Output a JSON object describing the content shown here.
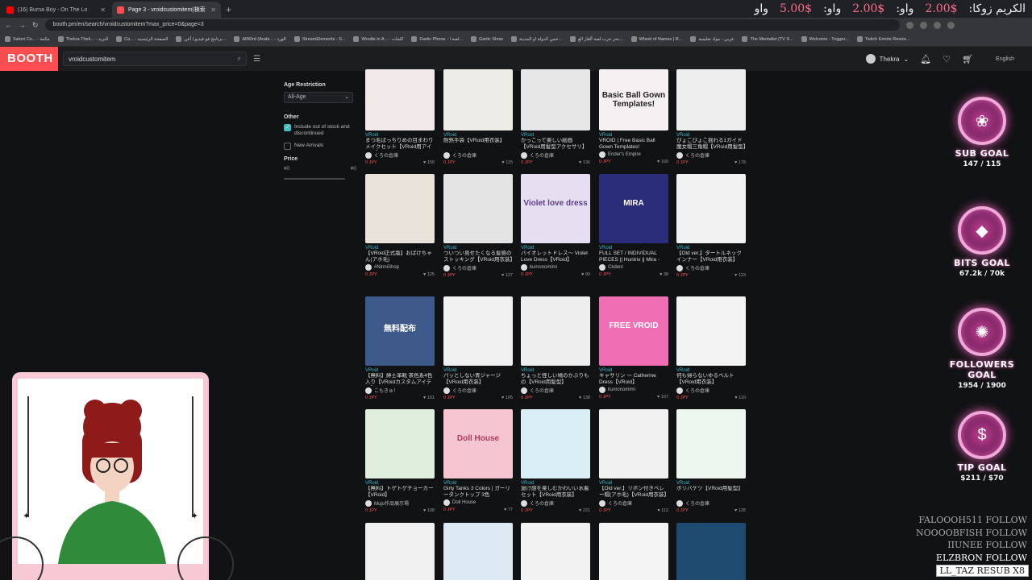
{
  "browser": {
    "tabs": [
      {
        "title": "(16) Burna Boy - On The Lo",
        "color": "#ff0000"
      },
      {
        "title": "Page 3 - vroidcustomitem(検索",
        "color": "#fc4d50"
      }
    ],
    "url": "booth.pm/en/search/vroidcustomitem?max_price=0&page=3",
    "bookmarks": [
      "Saloni Co... - مكتبة",
      "Thekra Thek... - البريد",
      "Ca... - الصفحة الرئيسية",
      "برنامج فو فيديو | أغن...",
      "AllWird (Arabi... - الورد",
      "StreamElements - S...",
      "Wordle in A... - كلمات",
      "Gartic Phone - لعبة ا...",
      "Gartic Show",
      "خمن الدولة او المدينة...",
      "بحر حرب لعبة ألغاز الع...",
      "Wheel of Names | R...",
      "عربي - مواد تعليمية",
      "The Mentalist (TV S...",
      "Welcome - Trigger...",
      "Twitch Emote Resize..."
    ]
  },
  "donations": {
    "a_label": "الكريم زوكا:",
    "a_amt": "2.00$",
    "b_label": "واو:",
    "b_amt": "2.00$",
    "c_label": "واو:",
    "c_amt": "5.00$",
    "d_label": "واو"
  },
  "booth": {
    "logo": "BOOTH",
    "search_value": "vroidcustomitem",
    "username": "Thekra",
    "language": "English"
  },
  "filters": {
    "age_title": "Age Restriction",
    "age_value": "All-Age",
    "other_title": "Other",
    "include_label": "Include out of stock and discontinued",
    "new_label": "New Arrivals",
    "price_title": "Price",
    "price_min": "¥0",
    "price_max": "¥0"
  },
  "products": [
    {
      "cat": "VRoid",
      "name": "まつ毛ばっちりめの目まわりメイクセット【VRoid用アイテム】",
      "shop": "くろの倉庫",
      "price": "0 JPY",
      "likes": "150",
      "bg": "#f1e9ea",
      "label": "",
      "lc": "#000"
    },
    {
      "cat": "VRoid",
      "name": "耐熱手袋【VRoid用衣装】",
      "shop": "くろの倉庫",
      "price": "0 JPY",
      "likes": "115",
      "bg": "#ecebe6",
      "label": "",
      "lc": "#000"
    },
    {
      "cat": "VRoid",
      "name": "かっこって楽しい絵画【VRoid用髪型アクセサリ】",
      "shop": "くろの倉庫",
      "price": "0 JPY",
      "likes": "136",
      "bg": "#e6e6e6",
      "label": "",
      "lc": "#000"
    },
    {
      "cat": "VRoid",
      "name": "VROID | Free Basic Ball Gown Templates!",
      "shop": "Ender's Empire",
      "price": "0 JPY",
      "likes": "160",
      "bg": "#f5f0f2",
      "label": "Basic Ball Gown Templates!",
      "lc": "#222"
    },
    {
      "cat": "VRoid",
      "name": "ぴょこぴょこ揺れる1ガイド魔女帽三角帽【VRoid用髪型】",
      "shop": "くろの倉庫",
      "price": "0 JPY",
      "likes": "178",
      "bg": "#eeeeee",
      "label": "",
      "lc": "#000"
    },
    {
      "cat": "VRoid",
      "name": "【VRoid正式版】おばけちゃん(アホ毛)",
      "shop": "#NinniShop",
      "price": "0 JPY",
      "likes": "125",
      "bg": "#e9e3dc",
      "label": "",
      "lc": "#000"
    },
    {
      "cat": "VRoid",
      "name": "ついつい見せたくなる髪感のストッキング【VRoid用衣装】",
      "shop": "くろの倉庫",
      "price": "0 JPY",
      "likes": "127",
      "bg": "#e4e4e4",
      "label": "",
      "lc": "#000"
    },
    {
      "cat": "VRoid",
      "name": "バイオレットドレス～ Violet Love Dress【VRoid】",
      "shop": "kumonomimi",
      "price": "0 JPY",
      "likes": "99",
      "bg": "#e6dff2",
      "label": "Violet love dress",
      "lc": "#5a3c8a"
    },
    {
      "cat": "VRoid",
      "name": "FULL SET / INDIVIDUAL PIECES || Huntrix || Mira - 'How ...",
      "shop": "Ckdeni",
      "price": "0 JPY",
      "likes": "38",
      "bg": "#2b2d7a",
      "label": "MIRA",
      "lc": "#ffffff"
    },
    {
      "cat": "VRoid",
      "name": "【Old ver.】タートルネックインナー【VRoid用衣装】",
      "shop": "くろの倉庫",
      "price": "0 JPY",
      "likes": "123",
      "bg": "#f2f2f2",
      "label": "",
      "lc": "#000"
    },
    {
      "cat": "VRoid",
      "name": "【無料】紳士革靴 茶色系4色入り【VRoidカスタムアイテム】",
      "shop": "こもきゅ！",
      "price": "0 JPY",
      "likes": "101",
      "bg": "#3e5a8a",
      "label": "無料配布",
      "lc": "#ffffff"
    },
    {
      "cat": "VRoid",
      "name": "パッとしない青ジャージ【VRoid用衣装】",
      "shop": "くろの倉庫",
      "price": "0 JPY",
      "likes": "105",
      "bg": "#f0f0f0",
      "label": "",
      "lc": "#000"
    },
    {
      "cat": "VRoid",
      "name": "ちょっと怪しい鳩のかぶりもの【VRoid用髪型】",
      "shop": "くろの倉庫",
      "price": "0 JPY",
      "likes": "138",
      "bg": "#eeeeee",
      "label": "",
      "lc": "#000"
    },
    {
      "cat": "VRoid",
      "name": "キャサリン ～ Catherine Dress【VRoid】",
      "shop": "kumonomimi",
      "price": "0 JPY",
      "likes": "107",
      "bg": "#f06eb4",
      "label": "FREE   VROID",
      "lc": "#ffffff"
    },
    {
      "cat": "VRoid",
      "name": "何も帰らないゆるベルト【VRoid用衣装】",
      "shop": "くろの倉庫",
      "price": "0 JPY",
      "likes": "110",
      "bg": "#f3f3f3",
      "label": "",
      "lc": "#000"
    },
    {
      "cat": "VRoid",
      "name": "【無料】トゲトゲチョーカー【VRoid】",
      "shop": "Mujo作品展示場",
      "price": "0 JPY",
      "likes": "108",
      "bg": "#dfeedd",
      "label": "",
      "lc": "#000"
    },
    {
      "cat": "VRoid",
      "name": "Girly Tanks 3 Colors | ガーリータンクトップ 3色",
      "shop": "Doll House",
      "price": "0 JPY",
      "likes": "77",
      "bg": "#f5c5d2",
      "label": "Doll House",
      "lc": "#b23a5a"
    },
    {
      "cat": "VRoid",
      "name": "過け感を楽しむかわいい水着セット【VRoid用衣装】",
      "shop": "くろの倉庫",
      "price": "0 JPY",
      "likes": "221",
      "bg": "#d9eef5",
      "label": "",
      "lc": "#000"
    },
    {
      "cat": "VRoid",
      "name": "【Old ver.】リボン付きベレー帽(アホ毛)【VRoid用衣装】",
      "shop": "くろの倉庫",
      "price": "0 JPY",
      "likes": "112",
      "bg": "#f1f1f1",
      "label": "",
      "lc": "#000"
    },
    {
      "cat": "VRoid",
      "name": "ボリバケツ【VRoid用髪型】",
      "shop": "くろの倉庫",
      "price": "0 JPY",
      "likes": "128",
      "bg": "#eef6f0",
      "label": "",
      "lc": "#000"
    },
    {
      "cat": "",
      "name": "",
      "shop": "",
      "price": "",
      "likes": "",
      "bg": "#f0f0f0",
      "label": "",
      "lc": "#000"
    },
    {
      "cat": "",
      "name": "",
      "shop": "",
      "price": "",
      "likes": "",
      "bg": "#dde9f2",
      "label": "",
      "lc": "#000"
    },
    {
      "cat": "",
      "name": "",
      "shop": "",
      "price": "",
      "likes": "",
      "bg": "#f2f2f2",
      "label": "",
      "lc": "#000"
    },
    {
      "cat": "",
      "name": "",
      "shop": "",
      "price": "",
      "likes": "",
      "bg": "#f4f4f4",
      "label": "",
      "lc": "#000"
    },
    {
      "cat": "",
      "name": "",
      "shop": "",
      "price": "",
      "likes": "",
      "bg": "#1d4a6e",
      "label": "",
      "lc": "#000"
    }
  ],
  "goals": [
    {
      "name": "SUB GOAL",
      "value": "147 / 115",
      "icon": "lotus-icon",
      "glyph": "❀"
    },
    {
      "name": "BITS GOAL",
      "value": "67.2k / 70k",
      "icon": "gem-icon",
      "glyph": "◆"
    },
    {
      "name": "FOLLOWERS GOAL",
      "value": "1954 / 1900",
      "icon": "star-burst-icon",
      "glyph": "✺"
    },
    {
      "name": "TIP GOAL",
      "value": "$211 / $70",
      "icon": "dollar-icon",
      "glyph": "$"
    }
  ],
  "feed": [
    "FALOOOH511 FOLLOW",
    "NOOOOBFISH FOLLOW",
    "IIUNEE FOLLOW",
    "ELZBRON FOLLOW"
  ],
  "resub": "LL_TAZ RESUB X8"
}
